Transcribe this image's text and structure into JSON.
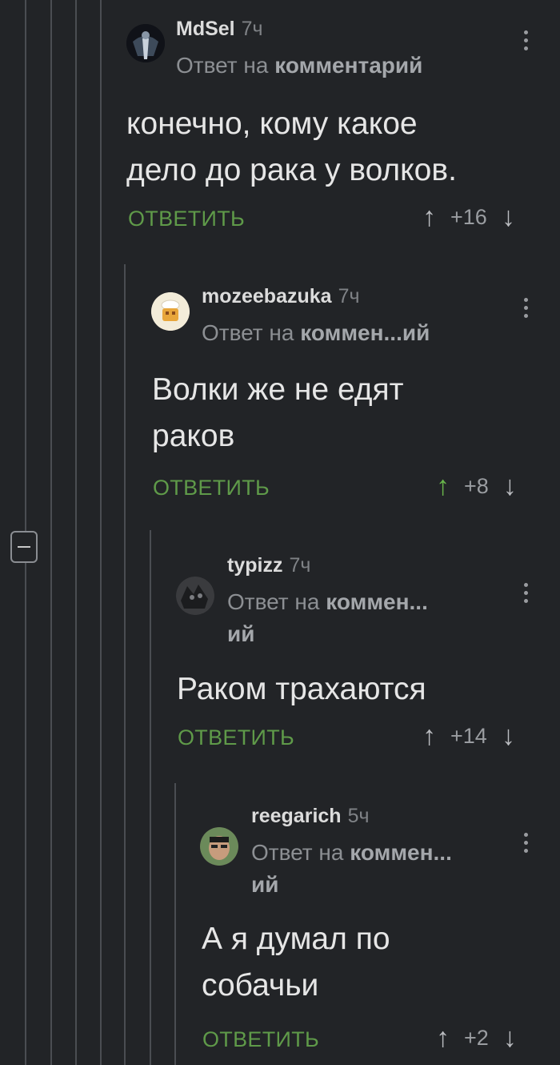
{
  "comments": [
    {
      "username": "MdSel",
      "time": "7ч",
      "reply_prefix": "Ответ на",
      "reply_target": "комментарий",
      "reply_target_2": "",
      "text_lines": [
        "конечно, кому какое",
        "дело до рака у волков."
      ],
      "reply_label": "ОТВЕТИТЬ",
      "score": "+16"
    },
    {
      "username": "mozeebazuka",
      "time": "7ч",
      "reply_prefix": "Ответ на",
      "reply_target": "коммен...ий",
      "reply_target_2": "",
      "text_lines": [
        "Волки же не едят",
        "раков"
      ],
      "reply_label": "ОТВЕТИТЬ",
      "score": "+8"
    },
    {
      "username": "typizz",
      "time": "7ч",
      "reply_prefix": "Ответ на",
      "reply_target": "коммен...",
      "reply_target_2": "ий",
      "text_lines": [
        "Раком трахаются"
      ],
      "reply_label": "ОТВЕТИТЬ",
      "score": "+14"
    },
    {
      "username": "reegarich",
      "time": "5ч",
      "reply_prefix": "Ответ на",
      "reply_target": "коммен...",
      "reply_target_2": "ий",
      "text_lines": [
        "А я думал по",
        "собачьи"
      ],
      "reply_label": "ОТВЕТИТЬ",
      "score": "+2"
    }
  ],
  "icons": {
    "upvote": "↑",
    "downvote": "↓",
    "collapse": "minus-square"
  },
  "colors": {
    "background": "#222427",
    "reply_green": "#5f9a49",
    "upvoted_arrow": "#69b64b"
  }
}
